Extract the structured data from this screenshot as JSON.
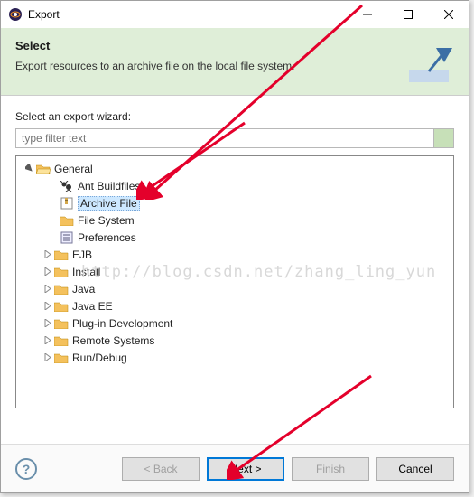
{
  "window": {
    "title": "Export"
  },
  "banner": {
    "heading": "Select",
    "description": "Export resources to an archive file on the local file system."
  },
  "content": {
    "wizard_label": "Select an export wizard:",
    "filter_placeholder": "type filter text"
  },
  "tree": {
    "general": "General",
    "ant": "Ant Buildfiles",
    "archive": "Archive File",
    "filesystem": "File System",
    "preferences": "Preferences",
    "ejb": "EJB",
    "install": "Install",
    "java": "Java",
    "javaee": "Java EE",
    "plugin": "Plug-in Development",
    "remote": "Remote Systems",
    "rundebug": "Run/Debug"
  },
  "watermark": "http://blog.csdn.net/zhang_ling_yun",
  "buttons": {
    "back": "< Back",
    "next": "Next >",
    "finish": "Finish",
    "cancel": "Cancel"
  }
}
